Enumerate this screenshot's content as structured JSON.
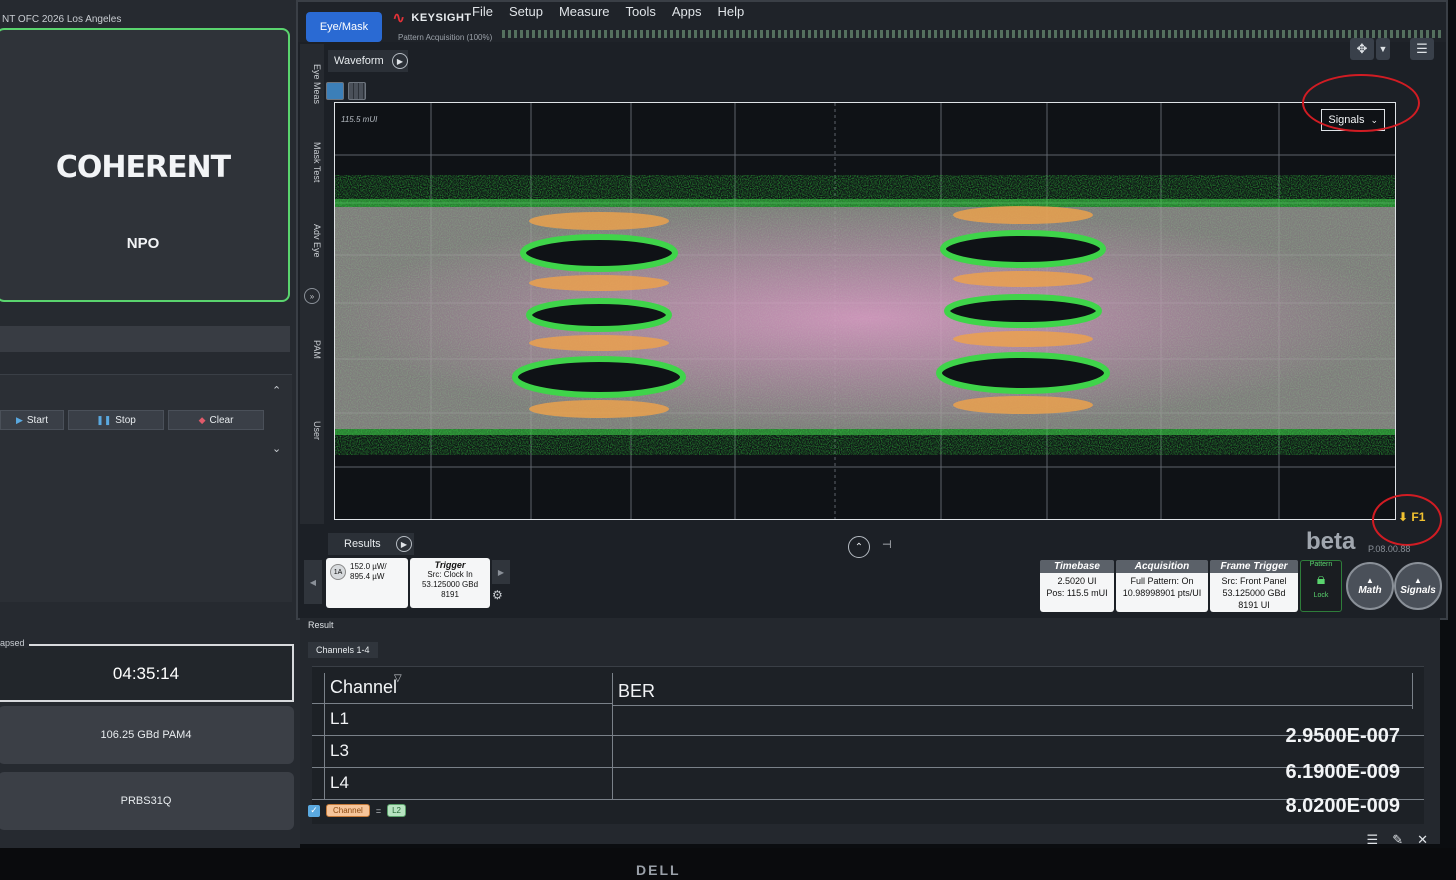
{
  "left": {
    "event_title": "NT OFC 2026 Los Angeles",
    "logo_text": "COHERENT",
    "logo_subtitle": "NPO",
    "buttons": {
      "start": "Start",
      "stop": "Stop",
      "clear": "Clear"
    },
    "elapsed_label": "apsed",
    "elapsed_value": "04:35:14",
    "rate": "106.25 GBd PAM4",
    "pattern": "PRBS31Q"
  },
  "scope": {
    "mode_button": "Eye/Mask",
    "brand": "KEYSIGHT",
    "menus": [
      "File",
      "Setup",
      "Measure",
      "Tools",
      "Apps",
      "Help"
    ],
    "acq_note": "Pattern Acquisition (100%)",
    "side_tabs": [
      "Eye Meas",
      "Mask Test",
      "Adv Eye",
      "PAM",
      "User"
    ],
    "waveform_tab": "Waveform",
    "scale_label": "115.5 mUI",
    "signals_dropdown": "Signals",
    "marker": "F1",
    "results_tab": "Results",
    "beta": "beta",
    "version": "P.08.00.88",
    "channel": {
      "badge": "1A",
      "power1": "152.0 µW/",
      "power2": "895.4 µW"
    },
    "trigger": {
      "title": "Trigger",
      "src": "Src: Clock In",
      "rate": "53.125000 GBd",
      "count": "8191"
    },
    "timebase": {
      "title": "Timebase",
      "line1": "2.5020 UI",
      "line2": "Pos: 115.5 mUI"
    },
    "acquisition": {
      "title": "Acquisition",
      "line1": "Full Pattern: On",
      "line2": "10.98998901 pts/UI"
    },
    "frame_trigger": {
      "title": "Frame Trigger",
      "line1": "Src: Front Panel",
      "line2": "53.125000 GBd",
      "line3": "8191 UI"
    },
    "pattern_lock": {
      "title": "Pattern",
      "label": "Lock"
    },
    "math_button": "Math",
    "signals_button": "Signals"
  },
  "result": {
    "title": "Result",
    "tab": "Channels 1-4",
    "columns": [
      "Channel",
      "BER"
    ],
    "rows": [
      {
        "channel": "L1",
        "ber": "2.9500E-007"
      },
      {
        "channel": "L3",
        "ber": "6.1900E-009"
      },
      {
        "channel": "L4",
        "ber": "8.0200E-009"
      }
    ],
    "chip_channel": "Channel",
    "chip_l2": "L2"
  },
  "bezel_brand": "DELL",
  "colors": {
    "accent_blue": "#2a6ad3",
    "trace_green": "#3fd44a",
    "trace_pink": "#e07ad0",
    "trace_orange": "#f0a24a",
    "annotation_red": "#d11c23"
  }
}
